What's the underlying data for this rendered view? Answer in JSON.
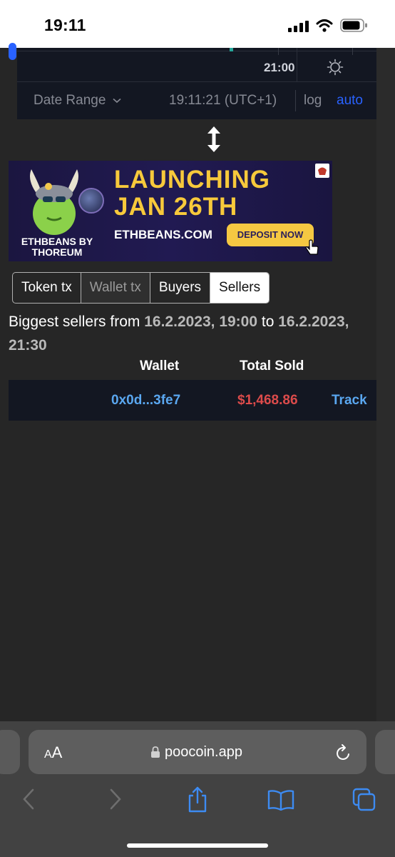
{
  "status_bar": {
    "time": "19:11"
  },
  "chart": {
    "time_axis_label": "21:00",
    "date_range_label": "Date Range",
    "clock": "19:11:21 (UTC+1)",
    "log_label": "log",
    "auto_label": "auto"
  },
  "ad": {
    "headline_line1": "LAUNCHING",
    "headline_line2": "JAN 26TH",
    "brand_line1": "ETHBEANS BY",
    "brand_line2": "THOREUM",
    "url": "ETHBEANS.COM",
    "cta": "DEPOSIT NOW"
  },
  "tabs": [
    {
      "label": "Token tx",
      "state": "normal"
    },
    {
      "label": "Wallet tx",
      "state": "disabled"
    },
    {
      "label": "Buyers",
      "state": "normal"
    },
    {
      "label": "Sellers",
      "state": "active"
    }
  ],
  "sellers": {
    "prefix": "Biggest sellers from ",
    "from": "16.2.2023, 19:00",
    "to_word": " to ",
    "to": "16.2.2023, 21:30",
    "columns": {
      "wallet": "Wallet",
      "total": "Total Sold"
    },
    "rows": [
      {
        "wallet": "0x0d...3fe7",
        "total": "$1,468.86",
        "action": "Track"
      }
    ]
  },
  "browser": {
    "aa_label": "AA",
    "url": "poocoin.app"
  },
  "colors": {
    "chart_bg": "#131722",
    "link_blue": "#5aa7f0",
    "sell_red": "#dc4b4b",
    "ad_yellow": "#f7c93b"
  }
}
